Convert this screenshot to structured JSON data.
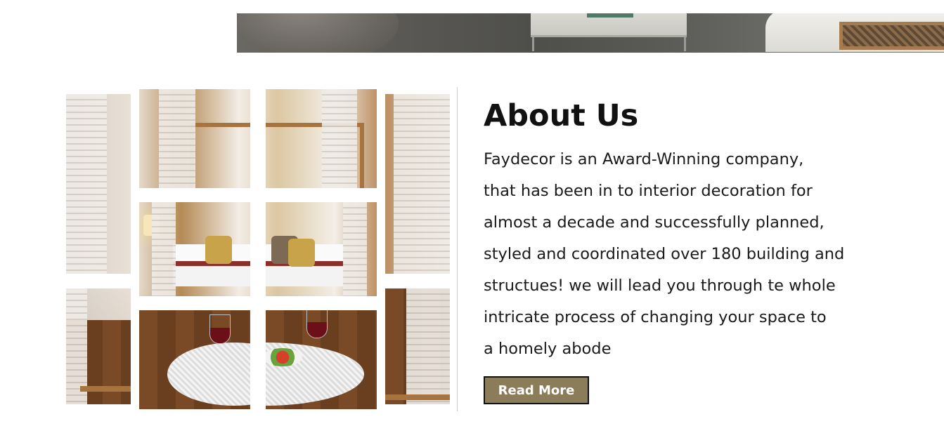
{
  "hero": {
    "image_description": "living room photo strip"
  },
  "gallery": {
    "tile_count": 12
  },
  "about": {
    "title": "About Us",
    "body": "Faydecor is an Award-Winning company,\nthat has been in to interior decoration for\nalmost a decade and successfully planned,\nstyled and coordinated over 180 building and\nstructues! we will lead you through te whole\nintricate process of changing your space to\na homely abode",
    "read_more_label": "Read More"
  },
  "colors": {
    "button_bg": "#8c7d5a",
    "button_border": "#111111",
    "title_text": "#111111",
    "body_text": "#1a1a1a"
  }
}
